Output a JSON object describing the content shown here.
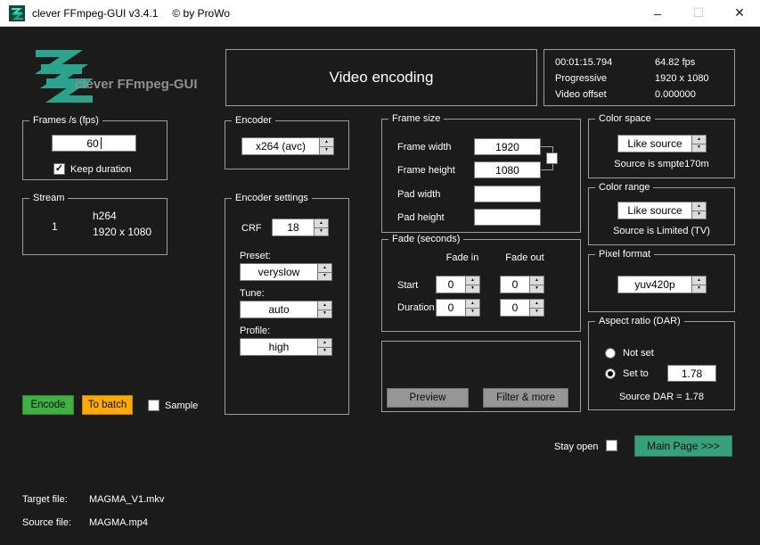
{
  "window": {
    "title": "clever FFmpeg-GUI v3.4.1",
    "copyright": "© by ProWo"
  },
  "icons": {
    "spin_up": "▲",
    "spin_down": "▼",
    "check": "✓",
    "minimize": "–",
    "maximize": "☐",
    "close": "✕"
  },
  "colors": {
    "background": "#1b1b1b",
    "accent_teal": "#2ba38d",
    "encode_green": "#3fb044",
    "batch_orange": "#ffaa00",
    "main_page_teal": "#38a17c"
  },
  "header": {
    "logo_text": "clever FFmpeg-GUI",
    "page_title": "Video encoding"
  },
  "info_box": {
    "rows": [
      {
        "left": "00:01:15.794",
        "right": "64.82 fps"
      },
      {
        "left": "Progressive",
        "right": "1920 x 1080"
      },
      {
        "left": "Video offset",
        "right": "0.000000"
      }
    ]
  },
  "fps_group": {
    "title": "Frames /s (fps)",
    "value": "60",
    "keep_duration": "Keep duration"
  },
  "stream_group": {
    "title": "Stream",
    "index": "1",
    "codec": "h264",
    "resolution": "1920 x 1080"
  },
  "encoder_group": {
    "title": "Encoder",
    "value": "x264 (avc)"
  },
  "encoder_settings": {
    "title": "Encoder settings",
    "crf_label": "CRF",
    "crf_value": "18",
    "preset_label": "Preset:",
    "preset_value": "veryslow",
    "tune_label": "Tune:",
    "tune_value": "auto",
    "profile_label": "Profile:",
    "profile_value": "high"
  },
  "frame_size": {
    "title": "Frame size",
    "rows": [
      {
        "label": "Frame width",
        "value": "1920"
      },
      {
        "label": "Frame height",
        "value": "1080"
      },
      {
        "label": "Pad width",
        "value": ""
      },
      {
        "label": "Pad height",
        "value": ""
      }
    ]
  },
  "fade": {
    "title": "Fade (seconds)",
    "fade_in": "Fade in",
    "fade_out": "Fade out",
    "start_label": "Start",
    "duration_label": "Duration",
    "start_in": "0",
    "start_out": "0",
    "duration_in": "0",
    "duration_out": "0"
  },
  "preview_group": {
    "preview": "Preview",
    "filter_more": "Filter & more"
  },
  "color_space": {
    "title": "Color space",
    "value": "Like source",
    "source_note": "Source is smpte170m"
  },
  "color_range": {
    "title": "Color range",
    "value": "Like source",
    "source_note": "Source is Limited (TV)"
  },
  "pixel_format": {
    "title": "Pixel format",
    "value": "yuv420p"
  },
  "aspect_ratio": {
    "title": "Aspect ratio (DAR)",
    "not_set": "Not set",
    "set_to": "Set to",
    "value": "1.78",
    "source_note": "Source DAR = 1.78"
  },
  "actions": {
    "encode": "Encode",
    "to_batch": "To batch",
    "sample": "Sample",
    "stay_open": "Stay open",
    "main_page": "Main Page >>>"
  },
  "files": {
    "target_label": "Target file:",
    "target_value": "MAGMA_V1.mkv",
    "source_label": "Source file:",
    "source_value": "MAGMA.mp4"
  }
}
